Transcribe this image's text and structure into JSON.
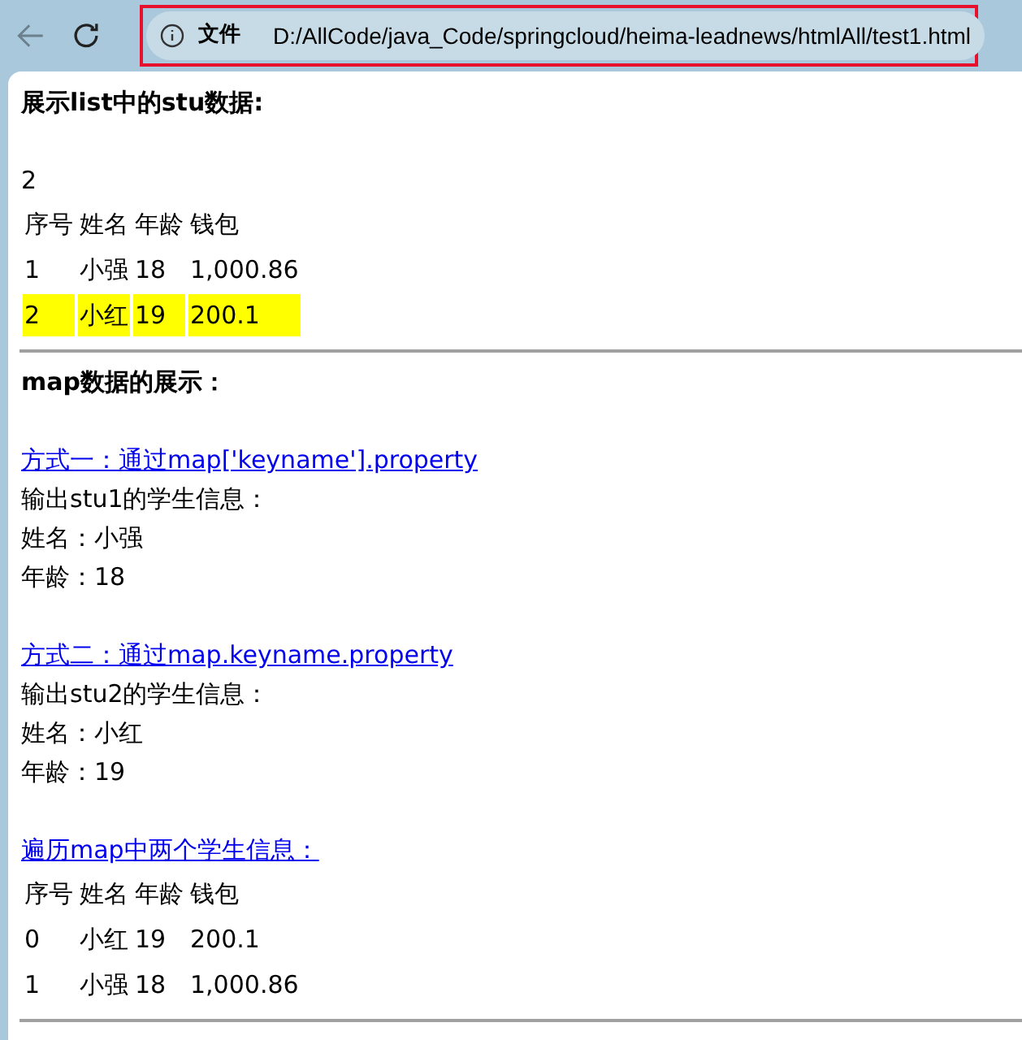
{
  "toolbar": {
    "address_bar": {
      "badge": "文件",
      "url": "D:/AllCode/java_Code/springcloud/heima-leadnews/htmlAll/test1.html",
      "highlighted": true
    }
  },
  "page": {
    "list_heading": "展示list中的stu数据:",
    "count": "2",
    "list_table": {
      "columns": [
        "序号",
        "姓名",
        "年龄",
        "钱包"
      ],
      "rows": [
        {
          "cells": [
            "1",
            "小强",
            "18",
            "1,000.86"
          ],
          "highlighted": false
        },
        {
          "cells": [
            "2",
            "小红",
            "19",
            "200.1"
          ],
          "highlighted": true
        }
      ]
    },
    "map_heading": "map数据的展示：",
    "section_1": {
      "link": "方式一：通过map['keyname'].property",
      "lines": [
        "输出stu1的学生信息：",
        "姓名：小强",
        "年龄：18"
      ]
    },
    "section_2": {
      "link": "方式二：通过map.keyname.property",
      "lines": [
        "输出stu2的学生信息：",
        "姓名：小红",
        "年龄：19"
      ]
    },
    "iterate_link": "遍历map中两个学生信息：",
    "map_table": {
      "columns": [
        "序号",
        "姓名",
        "年龄",
        "钱包"
      ],
      "rows": [
        {
          "cells": [
            "0",
            "小红",
            "19",
            "200.1"
          ],
          "highlighted": false
        },
        {
          "cells": [
            "1",
            "小强",
            "18",
            "1,000.86"
          ],
          "highlighted": false
        }
      ]
    }
  }
}
